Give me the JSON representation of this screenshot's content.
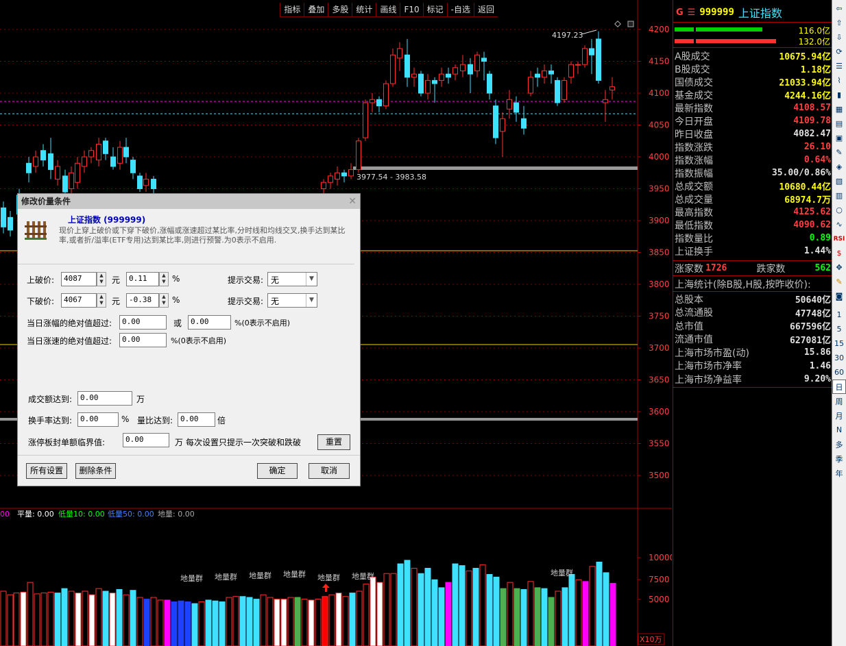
{
  "toolbar": {
    "items": [
      "指标",
      "叠加",
      "多股",
      "统计",
      "画线",
      "F10",
      "标记",
      "-自选",
      "返回"
    ]
  },
  "chart": {
    "price_axis": [
      "4200",
      "4150",
      "4100",
      "4050",
      "4000",
      "3950",
      "3900",
      "3850",
      "3800",
      "3750",
      "3700",
      "3650",
      "3600",
      "3550",
      "3500"
    ],
    "peak_label": "4197.23",
    "range_label": "3977.54 - 3983.58",
    "volume_axis": [
      "10000",
      "7500",
      "5000"
    ],
    "volume_unit": "X10万",
    "volume_legend": {
      "v1": "00",
      "ping_label": "平量:",
      "ping": "0.00",
      "di10_label": "低量10:",
      "di10": "0.00",
      "di50_label": "低量50:",
      "di50": "0.00",
      "di_label": "地量:",
      "di": "0.00"
    },
    "cluster_label": "地量群"
  },
  "right_panel": {
    "code": "999999",
    "name": "上证指数",
    "g": "G",
    "bar1": "116.0亿",
    "bar2": "132.0亿",
    "rows": [
      {
        "label": "A股成交",
        "value": "10675.94亿",
        "color": "#ffff00"
      },
      {
        "label": "B股成交",
        "value": "1.18亿",
        "color": "#ffff00"
      },
      {
        "label": "国债成交",
        "value": "21033.94亿",
        "color": "#ffff00"
      },
      {
        "label": "基金成交",
        "value": "4244.16亿",
        "color": "#ffff00"
      },
      {
        "label": "最新指数",
        "value": "4108.57",
        "color": "#ff4040"
      },
      {
        "label": "今日开盘",
        "value": "4109.78",
        "color": "#ff4040"
      },
      {
        "label": "昨日收盘",
        "value": "4082.47",
        "color": "#e0e0e0"
      },
      {
        "label": "指数涨跌",
        "value": "26.10",
        "color": "#ff4040"
      },
      {
        "label": "指数涨幅",
        "value": "0.64%",
        "color": "#ff4040"
      },
      {
        "label": "指数振幅",
        "value": "35.00/0.86%",
        "color": "#e0e0e0"
      },
      {
        "label": "总成交额",
        "value": "10680.44亿",
        "color": "#ffff00"
      },
      {
        "label": "总成交量",
        "value": "68974.7万",
        "color": "#ffff00"
      },
      {
        "label": "最高指数",
        "value": "4125.62",
        "color": "#ff4040"
      },
      {
        "label": "最低指数",
        "value": "4090.62",
        "color": "#ff4040"
      },
      {
        "label": "指数量比",
        "value": "0.89",
        "color": "#00ff00"
      },
      {
        "label": "上证换手",
        "value": "1.44%",
        "color": "#e0e0e0"
      }
    ],
    "up_label": "涨家数",
    "up_count": "1726",
    "down_label": "跌家数",
    "down_count": "562",
    "stats_title": "上海统计(除B股,H股,按昨收价):",
    "stats": [
      {
        "label": "总股本",
        "value": "50640亿"
      },
      {
        "label": "总流通股",
        "value": "47748亿"
      },
      {
        "label": "总市值",
        "value": "667596亿"
      },
      {
        "label": "流通市值",
        "value": "627081亿"
      },
      {
        "label": "上海市场市盈(动)",
        "value": "15.86"
      },
      {
        "label": "上海市场市净率",
        "value": "1.46"
      },
      {
        "label": "上海市场净益率",
        "value": "9.20%"
      }
    ]
  },
  "right_toolbar": [
    "1",
    "5",
    "15",
    "30",
    "60",
    "日",
    "周",
    "月",
    "N",
    "多",
    "季",
    "年"
  ],
  "dialog": {
    "title": "修改价量条件",
    "stock_name": "上证指数 (999999)",
    "description": "现价上穿上破价或下穿下破价,涨幅或涨速超过某比率,分时线和均线交叉,换手达到某比率,或者折/溢率(ETF专用)达到某比率,则进行预警.为0表示不启用.",
    "upper_label": "上破价:",
    "upper_value": "4087",
    "upper_unit": "元",
    "upper_pct": "0.11",
    "pct": "%",
    "lower_label": "下破价:",
    "lower_value": "4067",
    "lower_unit": "元",
    "lower_pct": "-0.38",
    "trade_label": "提示交易:",
    "trade_value": "无",
    "rise_label": "当日涨幅的绝对值超过:",
    "rise_value": "0.00",
    "or": "或",
    "rise_value2": "0.00",
    "rise_note": "%(0表示不启用)",
    "speed_label": "当日涨速的绝对值超过:",
    "speed_value": "0.00",
    "speed_note": "%(0表示不启用)",
    "amount_label": "成交额达到:",
    "amount_value": "0.00",
    "amount_unit": "万",
    "turnover_label": "换手率达到:",
    "turnover_value": "0.00",
    "turnover_unit": "%",
    "ratio_label": "量比达到:",
    "ratio_value": "0.00",
    "ratio_unit": "倍",
    "limit_label": "涨停板封单额临界值:",
    "limit_value": "0.00",
    "limit_unit": "万",
    "limit_note": "每次设置只提示一次突破和跌破",
    "reset": "重置",
    "all_settings": "所有设置",
    "delete": "删除条件",
    "ok": "确定",
    "cancel": "取消"
  }
}
